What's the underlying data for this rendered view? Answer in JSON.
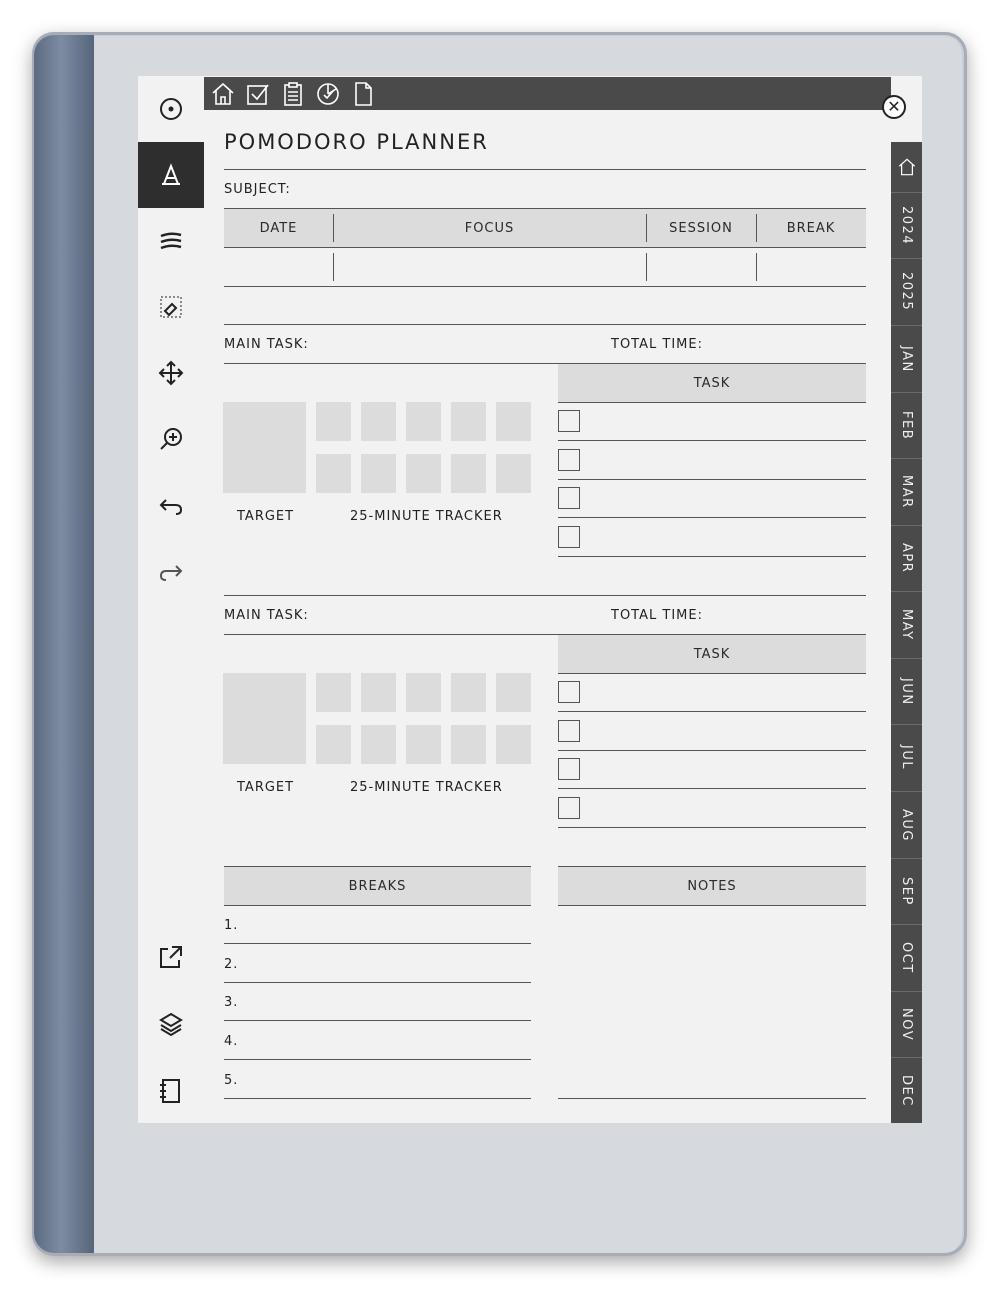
{
  "planner": {
    "title": "POMODORO PLANNER",
    "subject_label": "SUBJECT:",
    "columns": [
      "DATE",
      "FOCUS",
      "SESSION",
      "BREAK"
    ],
    "task_blocks": [
      {
        "main_task_label": "MAIN TASK:",
        "total_time_label": "TOTAL TIME:",
        "task_header": "TASK",
        "target_label": "TARGET",
        "tracker_label": "25-MINUTE TRACKER"
      },
      {
        "main_task_label": "MAIN TASK:",
        "total_time_label": "TOTAL TIME:",
        "task_header": "TASK",
        "target_label": "TARGET",
        "tracker_label": "25-MINUTE TRACKER"
      }
    ],
    "breaks_header": "BREAKS",
    "notes_header": "NOTES",
    "breaks": [
      "1.",
      "2.",
      "3.",
      "4.",
      "5."
    ]
  },
  "side_tabs": [
    "2024",
    "2025",
    "JAN",
    "FEB",
    "MAR",
    "APR",
    "MAY",
    "JUN",
    "JUL",
    "AUG",
    "SEP",
    "OCT",
    "NOV",
    "DEC"
  ],
  "icons": {
    "toolbar": [
      "menu-circle-icon",
      "pen-tool-icon",
      "stroke-icon",
      "eraser-icon",
      "move-icon",
      "zoom-icon",
      "undo-icon",
      "redo-icon",
      "share-icon",
      "layers-icon",
      "notebook-icon"
    ],
    "navbar": [
      "home-icon",
      "checkbox-icon",
      "clipboard-icon",
      "chart-icon",
      "page-icon"
    ]
  },
  "colors": {
    "navbar": "#4a4a4a",
    "header_fill": "#dcdcdc",
    "active_tool": "#2e2e2e"
  }
}
